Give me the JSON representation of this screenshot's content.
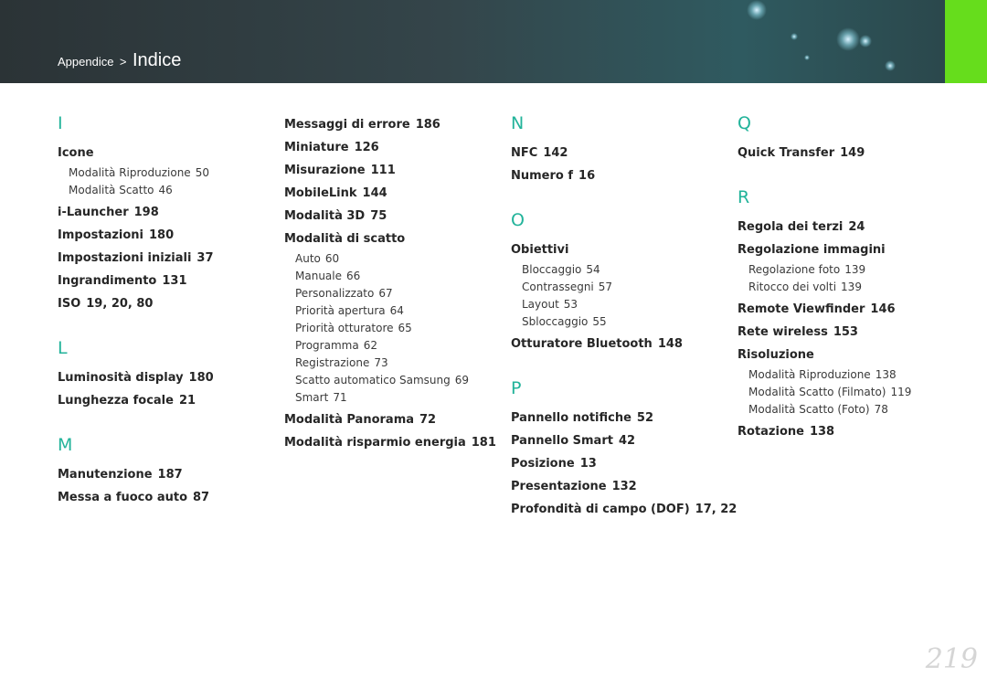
{
  "header": {
    "breadcrumb_parent": "Appendice",
    "breadcrumb_sep": ">",
    "breadcrumb_current": "Indice",
    "accent_color": "#66dd1c"
  },
  "colors": {
    "letter": "#22b39a",
    "header_bg": "#2f3c40"
  },
  "columns": [
    [
      {
        "letter": "I",
        "entries": [
          {
            "label": "Icone",
            "page": "",
            "subs": [
              {
                "label": "Modalità Riproduzione",
                "page": "50"
              },
              {
                "label": "Modalità Scatto",
                "page": "46"
              }
            ]
          },
          {
            "label": "i-Launcher",
            "page": "198",
            "subs": []
          },
          {
            "label": "Impostazioni",
            "page": "180",
            "subs": []
          },
          {
            "label": "Impostazioni iniziali",
            "page": "37",
            "subs": []
          },
          {
            "label": "Ingrandimento",
            "page": "131",
            "subs": []
          },
          {
            "label": "ISO",
            "page": "19, 20, 80",
            "subs": []
          }
        ]
      },
      {
        "letter": "L",
        "entries": [
          {
            "label": "Luminosità display",
            "page": "180",
            "subs": []
          },
          {
            "label": "Lunghezza focale",
            "page": "21",
            "subs": []
          }
        ]
      },
      {
        "letter": "M",
        "entries": [
          {
            "label": "Manutenzione",
            "page": "187",
            "subs": []
          },
          {
            "label": "Messa a fuoco auto",
            "page": "87",
            "subs": []
          }
        ]
      }
    ],
    [
      {
        "letter": "",
        "entries": [
          {
            "label": "Messaggi di errore",
            "page": "186",
            "subs": []
          },
          {
            "label": "Miniature",
            "page": "126",
            "subs": []
          },
          {
            "label": "Misurazione",
            "page": "111",
            "subs": []
          },
          {
            "label": "MobileLink",
            "page": "144",
            "subs": []
          },
          {
            "label": "Modalità 3D",
            "page": "75",
            "subs": []
          },
          {
            "label": "Modalità di scatto",
            "page": "",
            "subs": [
              {
                "label": "Auto",
                "page": "60"
              },
              {
                "label": "Manuale",
                "page": "66"
              },
              {
                "label": "Personalizzato",
                "page": "67"
              },
              {
                "label": "Priorità apertura",
                "page": "64"
              },
              {
                "label": "Priorità otturatore",
                "page": "65"
              },
              {
                "label": "Programma",
                "page": "62"
              },
              {
                "label": "Registrazione",
                "page": "73"
              },
              {
                "label": "Scatto automatico Samsung",
                "page": "69"
              },
              {
                "label": "Smart",
                "page": "71"
              }
            ]
          },
          {
            "label": "Modalità Panorama",
            "page": "72",
            "subs": []
          },
          {
            "label": "Modalità risparmio energia",
            "page": "181",
            "subs": []
          }
        ]
      }
    ],
    [
      {
        "letter": "N",
        "entries": [
          {
            "label": "NFC",
            "page": "142",
            "subs": []
          },
          {
            "label": "Numero f",
            "page": "16",
            "subs": []
          }
        ]
      },
      {
        "letter": "O",
        "entries": [
          {
            "label": "Obiettivi",
            "page": "",
            "subs": [
              {
                "label": "Bloccaggio",
                "page": "54"
              },
              {
                "label": "Contrassegni",
                "page": "57"
              },
              {
                "label": "Layout",
                "page": "53"
              },
              {
                "label": "Sbloccaggio",
                "page": "55"
              }
            ]
          },
          {
            "label": "Otturatore Bluetooth",
            "page": "148",
            "subs": []
          }
        ]
      },
      {
        "letter": "P",
        "entries": [
          {
            "label": "Pannello notifiche",
            "page": "52",
            "subs": []
          },
          {
            "label": "Pannello Smart",
            "page": "42",
            "subs": []
          },
          {
            "label": "Posizione",
            "page": "13",
            "subs": []
          },
          {
            "label": "Presentazione",
            "page": "132",
            "subs": []
          },
          {
            "label": "Profondità di campo (DOF)",
            "page": "17, 22",
            "subs": []
          }
        ]
      }
    ],
    [
      {
        "letter": "Q",
        "entries": [
          {
            "label": "Quick Transfer",
            "page": "149",
            "subs": []
          }
        ]
      },
      {
        "letter": "R",
        "entries": [
          {
            "label": "Regola dei terzi",
            "page": "24",
            "subs": []
          },
          {
            "label": "Regolazione immagini",
            "page": "",
            "subs": [
              {
                "label": "Regolazione foto",
                "page": "139"
              },
              {
                "label": "Ritocco dei volti",
                "page": "139"
              }
            ]
          },
          {
            "label": "Remote Viewfinder",
            "page": "146",
            "subs": []
          },
          {
            "label": "Rete wireless",
            "page": "153",
            "subs": []
          },
          {
            "label": "Risoluzione",
            "page": "",
            "subs": [
              {
                "label": "Modalità Riproduzione",
                "page": "138"
              },
              {
                "label": "Modalità Scatto (Filmato)",
                "page": "119"
              },
              {
                "label": "Modalità Scatto (Foto)",
                "page": "78"
              }
            ]
          },
          {
            "label": "Rotazione",
            "page": "138",
            "subs": []
          }
        ]
      }
    ]
  ],
  "page_number": "219"
}
